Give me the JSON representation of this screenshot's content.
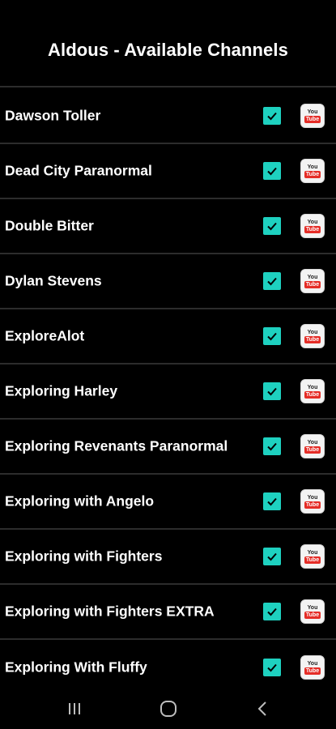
{
  "header": {
    "title": "Aldous - Available Channels"
  },
  "channels": [
    {
      "name": "Dawson Toller",
      "checked": true
    },
    {
      "name": "Dead City Paranormal",
      "checked": true
    },
    {
      "name": "Double Bitter",
      "checked": true
    },
    {
      "name": "Dylan Stevens",
      "checked": true
    },
    {
      "name": "ExploreAlot",
      "checked": true
    },
    {
      "name": "Exploring Harley",
      "checked": true
    },
    {
      "name": "Exploring Revenants Paranormal",
      "checked": true
    },
    {
      "name": "Exploring with Angelo",
      "checked": true
    },
    {
      "name": "Exploring with Fighters",
      "checked": true
    },
    {
      "name": "Exploring with Fighters EXTRA",
      "checked": true
    },
    {
      "name": "Exploring With Fluffy",
      "checked": true
    }
  ],
  "youtube_icon": {
    "line1": "You",
    "line2": "Tube"
  },
  "navbar": {
    "icons": [
      "recent-apps-icon",
      "home-icon",
      "back-icon"
    ]
  },
  "colors": {
    "accent": "#1ed1c0",
    "youtube_red": "#e52d27",
    "background": "#000000"
  }
}
